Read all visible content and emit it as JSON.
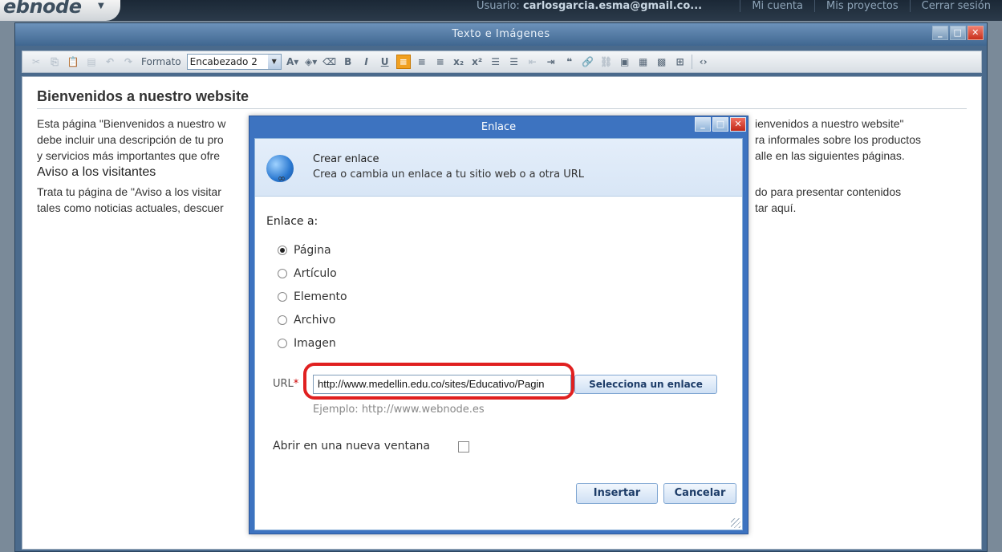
{
  "topbar": {
    "logo": "ebnode",
    "user_label": "Usuario:",
    "user_email": "carlosgarcia.esma@gmail.co...",
    "links": [
      "Mi cuenta",
      "Mis proyectos",
      "Cerrar sesión"
    ]
  },
  "editor": {
    "title": "Texto e Imágenes",
    "toolbar": {
      "format_label": "Formato",
      "format_value": "Encabezado 2"
    },
    "content": {
      "heading1": "Bienvenidos a nuestro website",
      "paragraph1_left": "Esta página \"Bienvenidos a nuestro w",
      "paragraph1_left_2": "debe incluir una descripción de tu pro",
      "paragraph1_left_3": "y servicios más importantes que ofre",
      "paragraph1_right": "ienvenidos a nuestro website\"",
      "paragraph1_right_2": "ra informales sobre los productos",
      "paragraph1_right_3": "alle en las siguientes páginas.",
      "heading2": "Aviso a los visitantes",
      "paragraph2_left": "Trata tu página de \"Aviso a los visitar",
      "paragraph2_left_2": "tales como noticias actuales, descuer",
      "paragraph2_right": "do para presentar contenidos",
      "paragraph2_right_2": "tar aquí."
    }
  },
  "dialog": {
    "title": "Enlace",
    "header_title": "Crear enlace",
    "header_subtitle": "Crea o cambia un enlace a tu sitio web o a otra URL",
    "link_to_label": "Enlace a:",
    "options": [
      "Página",
      "Artículo",
      "Elemento",
      "Archivo",
      "Imagen"
    ],
    "selected_option": "Página",
    "url_label": "URL",
    "url_required": "*",
    "url_value": "http://www.medellin.edu.co/sites/Educativo/Pagin",
    "select_link_button": "Selecciona un enlace",
    "example": "Ejemplo: http://www.webnode.es",
    "new_window_label": "Abrir en una nueva ventana",
    "new_window_checked": false,
    "insert_button": "Insertar",
    "cancel_button": "Cancelar"
  },
  "colors": {
    "dialog_frame": "#3d73c0",
    "highlight": "#e02020",
    "active_tool": "#f0a020"
  }
}
